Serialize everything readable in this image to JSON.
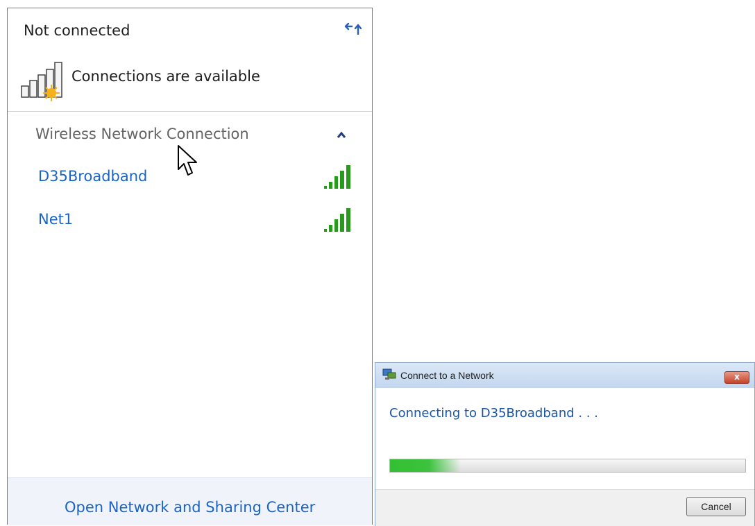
{
  "flyout": {
    "status_title": "Not connected",
    "connections_status": "Connections are available",
    "section_header": "Wireless Network Connection",
    "networks": [
      {
        "name": "D35Broadband",
        "signal_bars": 5,
        "signal_color": "#2a9a1f"
      },
      {
        "name": "Net1",
        "signal_bars": 5,
        "signal_color": "#2a9a1f"
      }
    ],
    "footer_link": "Open Network and Sharing Center",
    "icons": {
      "refresh": "refresh-arrows-icon",
      "status": "signal-warning-icon",
      "collapse": "chevron-up-icon",
      "network_signal": "signal-bars-icon"
    },
    "colors": {
      "link": "#1a64c4",
      "header": "#646464",
      "footer_bg": "#f0f3f9"
    }
  },
  "dialog": {
    "title": "Connect to a Network",
    "message": "Connecting to D35Broadband . . .",
    "progress": 0.2,
    "cancel_label": "Cancel",
    "close_label": "x",
    "colors": {
      "progress": "#33c033",
      "message": "#1a54a8",
      "close": "#c6432a"
    }
  }
}
